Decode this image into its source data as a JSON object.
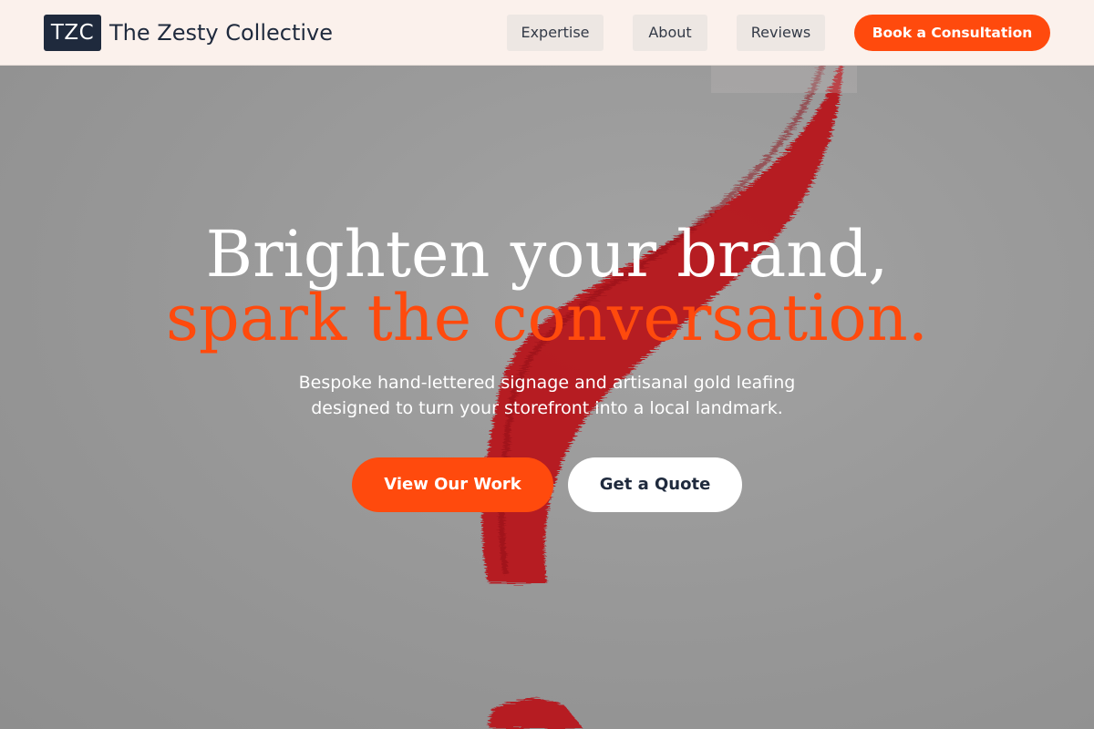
{
  "header": {
    "logo_text": "TZC",
    "brand_name": "The Zesty Collective",
    "nav": {
      "expertise": "Expertise",
      "about": "About",
      "reviews": "Reviews"
    },
    "cta_label": "Book a Consultation"
  },
  "hero": {
    "headline_line1": "Brighten your brand,",
    "headline_line2": "spark the conversation.",
    "subtext_line1": "Bespoke hand-lettered signage and artisanal gold leafing",
    "subtext_line2": "designed to turn your storefront into a local landmark.",
    "primary_button": "View Our Work",
    "secondary_button": "Get a Quote",
    "background_image": "red-brush-stroke"
  },
  "colors": {
    "accent": "#ff4a0d",
    "navy": "#1f2a3d",
    "header_bg": "#fbf1ec",
    "hero_bg": "#9a9a9a",
    "brush_red": "#b8121f"
  }
}
